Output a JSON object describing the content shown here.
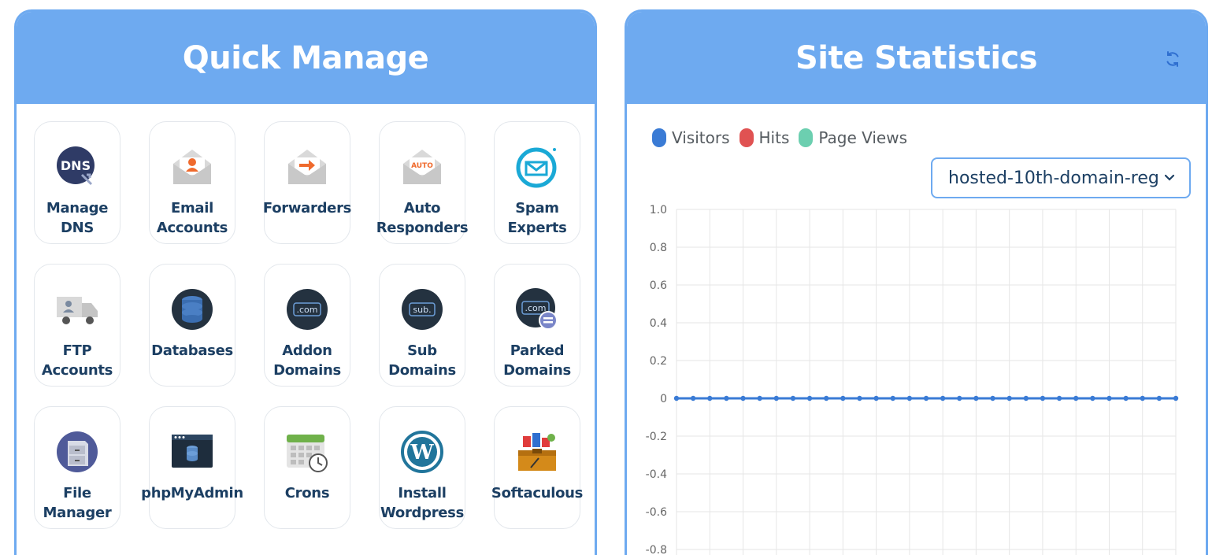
{
  "quick_manage": {
    "title": "Quick Manage",
    "tiles": [
      {
        "label": "Manage\nDNS",
        "icon": "dns-icon"
      },
      {
        "label": "Email\nAccounts",
        "icon": "email-accounts-icon"
      },
      {
        "label": "Forwarders",
        "icon": "forwarders-icon"
      },
      {
        "label": "Auto\nResponders",
        "icon": "auto-responders-icon"
      },
      {
        "label": "Spam\nExperts",
        "icon": "spam-experts-icon"
      },
      {
        "label": "FTP\nAccounts",
        "icon": "ftp-truck-icon"
      },
      {
        "label": "Databases",
        "icon": "database-icon"
      },
      {
        "label": "Addon\nDomains",
        "icon": "addon-domain-icon"
      },
      {
        "label": "Sub\nDomains",
        "icon": "sub-domain-icon"
      },
      {
        "label": "Parked\nDomains",
        "icon": "parked-domain-icon"
      },
      {
        "label": "File\nManager",
        "icon": "file-cabinet-icon"
      },
      {
        "label": "phpMyAdmin",
        "icon": "phpmyadmin-icon"
      },
      {
        "label": "Crons",
        "icon": "calendar-clock-icon"
      },
      {
        "label": "Install\nWordpress",
        "icon": "wordpress-icon"
      },
      {
        "label": "Softaculous",
        "icon": "softaculous-icon"
      }
    ],
    "icon_texts": {
      "dns": "DNS",
      "auto": "AUTO",
      "com": ".com",
      "sub": "sub."
    }
  },
  "site_statistics": {
    "title": "Site Statistics",
    "refresh_icon": "refresh-icon",
    "domain_select": {
      "selected": "hosted-10th-domain-reg"
    }
  },
  "colors": {
    "header": "#6eaaf0",
    "visitors": "#3a7bd5",
    "hits": "#e05252",
    "page_views": "#6ccfb0",
    "label_text": "#1c3f63"
  },
  "chart_data": {
    "type": "line",
    "legend": [
      "Visitors",
      "Hits",
      "Page Views"
    ],
    "legend_position": "top-left",
    "ylim": [
      -0.8,
      1.0
    ],
    "yticks": [
      "1.0",
      "0.8",
      "0.6",
      "0.4",
      "0.2",
      "0",
      "-0.2",
      "-0.4",
      "-0.6",
      "-0.8"
    ],
    "grid": true,
    "series": [
      {
        "name": "Visitors",
        "values": [
          0,
          0,
          0,
          0,
          0,
          0,
          0,
          0,
          0,
          0,
          0,
          0,
          0,
          0,
          0,
          0,
          0,
          0,
          0,
          0,
          0,
          0,
          0,
          0,
          0,
          0,
          0,
          0,
          0,
          0,
          0
        ]
      }
    ]
  }
}
